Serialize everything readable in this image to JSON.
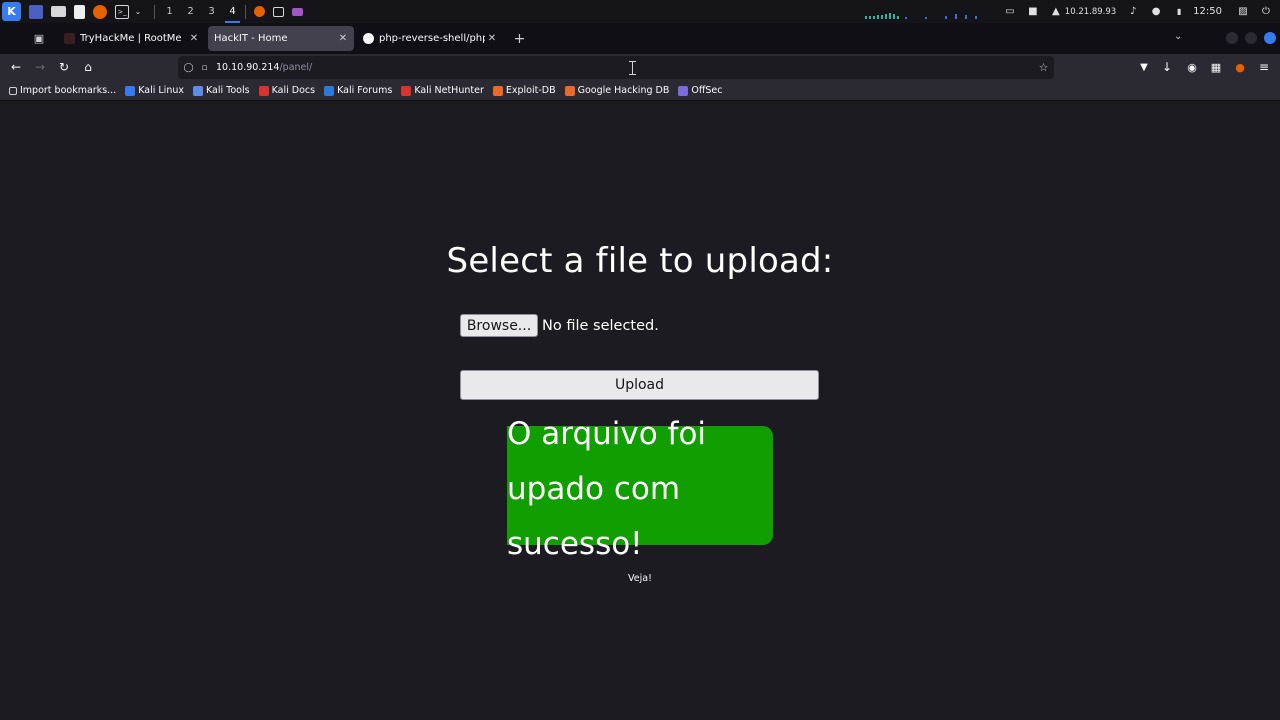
{
  "taskbar": {
    "workspaces": [
      "1",
      "2",
      "3",
      "4"
    ],
    "active_workspace": "4",
    "ip": "10.21.89.93",
    "time": "12:50"
  },
  "tabs": [
    {
      "title": "TryHackMe | RootMe",
      "active": false
    },
    {
      "title": "HackIT - Home",
      "active": true
    },
    {
      "title": "php-reverse-shell/php-re",
      "active": false
    }
  ],
  "navbar": {
    "url_host": "10.10.90.214",
    "url_path": "/panel/"
  },
  "bookmarks": [
    {
      "label": "Import bookmarks...",
      "color": "#cfcfd8"
    },
    {
      "label": "Kali Linux",
      "color": "#367bf0"
    },
    {
      "label": "Kali Tools",
      "color": "#5e8de8"
    },
    {
      "label": "Kali Docs",
      "color": "#d8342c"
    },
    {
      "label": "Kali Forums",
      "color": "#2e78d7"
    },
    {
      "label": "Kali NetHunter",
      "color": "#d8342c"
    },
    {
      "label": "Exploit-DB",
      "color": "#e96b2b"
    },
    {
      "label": "Google Hacking DB",
      "color": "#e96b2b"
    },
    {
      "label": "OffSec",
      "color": "#7b6cd9"
    }
  ],
  "page": {
    "heading": "Select a file to upload:",
    "browse_label": "Browse...",
    "file_status": "No file selected.",
    "upload_label": "Upload",
    "success_message": "O arquivo foi upado com sucesso!",
    "veja": "Veja!",
    "success_color": "#109e00"
  }
}
